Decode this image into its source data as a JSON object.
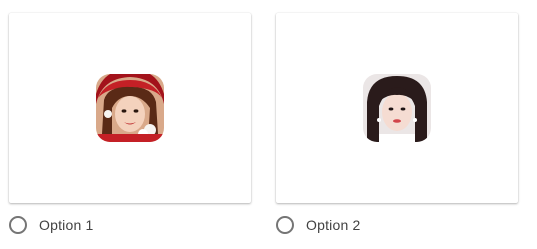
{
  "options": [
    {
      "label": "Option 1",
      "image": "portrait-red-hat",
      "selected": false
    },
    {
      "label": "Option 2",
      "image": "portrait-dark-hair",
      "selected": false
    }
  ],
  "colors": {
    "radio_border": "#757575",
    "label_text": "#424242",
    "card_background": "#ffffff"
  }
}
